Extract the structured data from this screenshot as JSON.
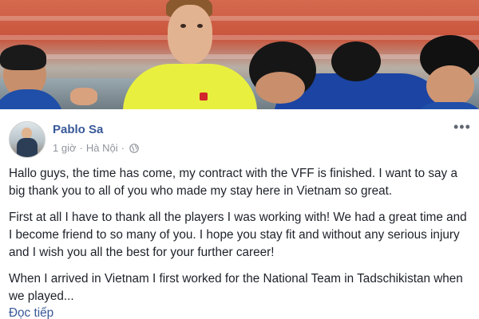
{
  "post": {
    "author": "Pablo Sa",
    "time": "1 giờ",
    "separator": "·",
    "location": "Hà Nội",
    "separator2": "·",
    "icons": {
      "privacy": "globe-icon",
      "menu": "more-horizontal-icon",
      "avatar": "profile-photo"
    },
    "paragraphs": [
      "Hallo guys, the time has come, my contract with the VFF is finished. I want to say a big thank you to all of you who made my stay here in Vietnam so great.",
      "First at all I have to thank all the players I was working with! We had a great time and I become friend to so many of you. I hope you stay fit and without any serious injury and I wish you all the best for your further career!",
      "When I arrived in Vietnam I first worked for the National Team in Tadschikistan when we played..."
    ],
    "see_more": "Đọc tiếp",
    "colors": {
      "author_link": "#385898",
      "meta_text": "#90949c",
      "body_text": "#1d2129"
    }
  }
}
